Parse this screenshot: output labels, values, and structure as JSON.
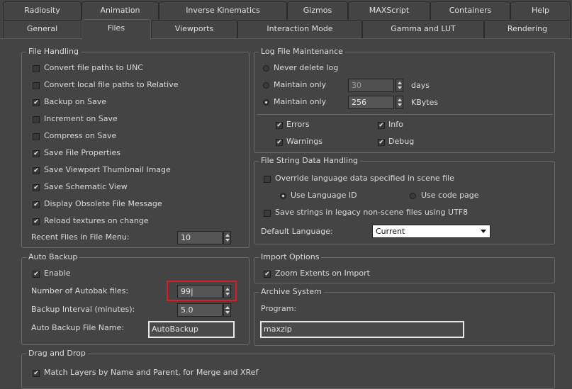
{
  "tabs_row1": [
    "Radiosity",
    "Animation",
    "Inverse Kinematics",
    "Gizmos",
    "MAXScript",
    "Containers",
    "Help"
  ],
  "tabs_row2": [
    "General",
    "Files",
    "Viewports",
    "Interaction Mode",
    "Gamma and LUT",
    "Rendering"
  ],
  "active_tab": "Files",
  "file_handling": {
    "title": "File Handling",
    "options": [
      {
        "label": "Convert file paths to UNC",
        "checked": false
      },
      {
        "label": "Convert local file paths to Relative",
        "checked": false
      },
      {
        "label": "Backup on Save",
        "checked": true
      },
      {
        "label": "Increment on Save",
        "checked": false
      },
      {
        "label": "Compress on Save",
        "checked": false
      },
      {
        "label": "Save File Properties",
        "checked": true
      },
      {
        "label": "Save Viewport Thumbnail Image",
        "checked": true
      },
      {
        "label": "Save Schematic View",
        "checked": true
      },
      {
        "label": "Display Obsolete File Message",
        "checked": true
      },
      {
        "label": "Reload textures on change",
        "checked": true
      }
    ],
    "recent_files_label": "Recent Files in File Menu:",
    "recent_files_value": "10"
  },
  "auto_backup": {
    "title": "Auto Backup",
    "enable_label": "Enable",
    "enable_checked": true,
    "num_files_label": "Number of Autobak files:",
    "num_files_value": "99|",
    "interval_label": "Backup Interval (minutes):",
    "interval_value": "5.0",
    "file_name_label": "Auto Backup File Name:",
    "file_name_value": "AutoBackup"
  },
  "log_file": {
    "title": "Log File Maintenance",
    "never_delete_label": "Never delete log",
    "maintain_days_label": "Maintain only",
    "maintain_days_value": "30",
    "days_unit": "days",
    "maintain_kb_label": "Maintain only",
    "maintain_kb_value": "256",
    "kb_unit": "KBytes",
    "selected_option": 2,
    "errors_label": "Errors",
    "errors_checked": true,
    "warnings_label": "Warnings",
    "warnings_checked": true,
    "info_label": "Info",
    "info_checked": true,
    "debug_label": "Debug",
    "debug_checked": true
  },
  "file_string": {
    "title": "File String Data Handling",
    "override_label": "Override language data specified in scene file",
    "override_checked": false,
    "use_language_id_label": "Use Language ID",
    "use_code_page_label": "Use code page",
    "use_language_id_selected": true,
    "save_utf8_label": "Save strings in legacy non-scene files using UTF8",
    "save_utf8_checked": false,
    "default_language_label": "Default Language:",
    "default_language_value": "Current"
  },
  "import_options": {
    "title": "Import Options",
    "zoom_extents_label": "Zoom Extents on Import",
    "zoom_extents_checked": true
  },
  "archive_system": {
    "title": "Archive System",
    "program_label": "Program:",
    "program_value": "maxzip"
  },
  "drag_drop": {
    "title": "Drag and Drop",
    "match_layers_label": "Match Layers by Name and Parent, for Merge and XRef",
    "match_layers_checked": true
  },
  "colors": {
    "background": "#444444",
    "highlight_border": "#d81f26"
  }
}
